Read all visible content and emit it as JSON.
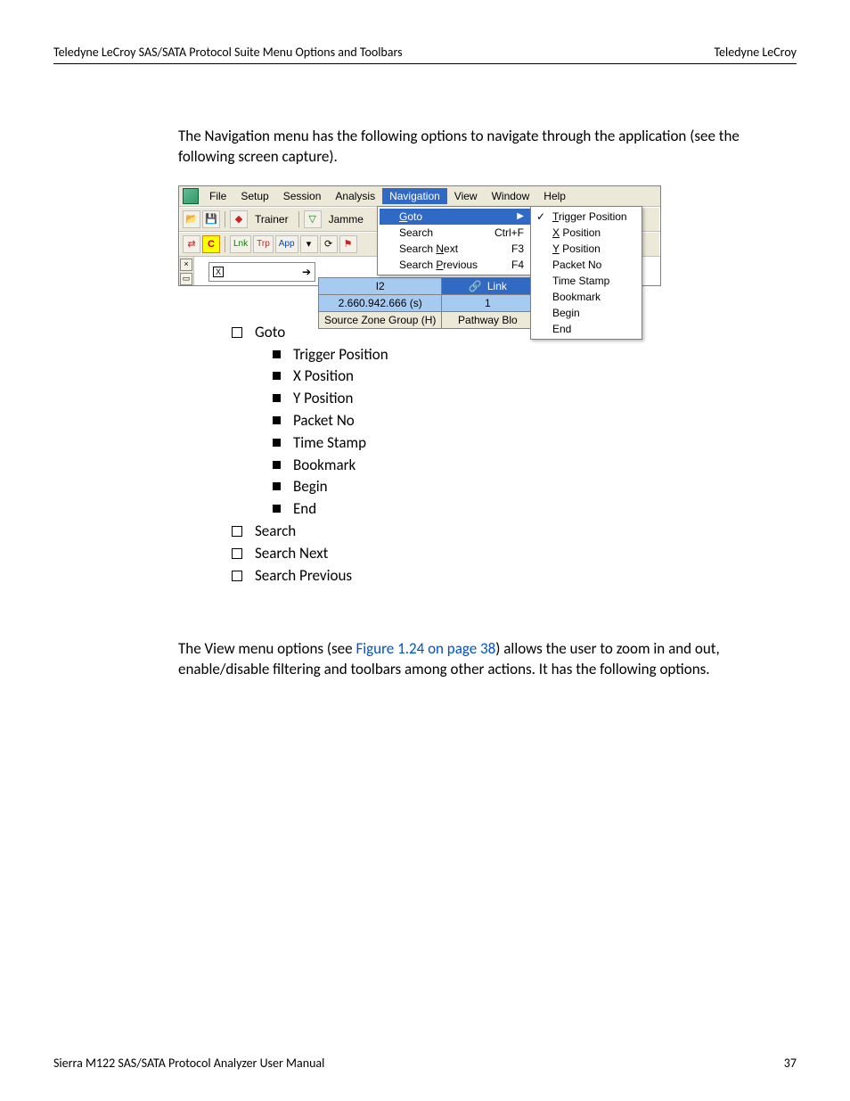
{
  "header": {
    "left": "Teledyne LeCroy SAS/SATA Protocol Suite Menu Options and Toolbars",
    "right": "Teledyne LeCroy"
  },
  "para1": "The Navigation menu has the following options to navigate through the application (see the following screen capture).",
  "screenshot": {
    "menubar": [
      "File",
      "Setup",
      "Session",
      "Analysis",
      "Navigation",
      "View",
      "Window",
      "Help"
    ],
    "toolbar1": {
      "trainer": "Trainer",
      "jamme": "Jamme"
    },
    "toolbar2": {
      "lnk": "Lnk",
      "trp": "Trp",
      "app": "App"
    },
    "grid": {
      "i2": "I2",
      "time": "2.660.942.666 (s)",
      "link": "Link",
      "one": "1",
      "src": "Source Zone Group (H)",
      "path": "Pathway Blo"
    },
    "navmenu": [
      {
        "label": "Goto",
        "shortcut": "",
        "arrow": true
      },
      {
        "label": "Search",
        "shortcut": "Ctrl+F"
      },
      {
        "label": "Search Next",
        "shortcut": "F3"
      },
      {
        "label": "Search Previous",
        "shortcut": "F4"
      }
    ],
    "gotomenu": [
      "Trigger Position",
      "X Position",
      "Y Position",
      "Packet No",
      "Time Stamp",
      "Bookmark",
      "Begin",
      "End"
    ]
  },
  "list": {
    "top": [
      "Goto"
    ],
    "goto_items": [
      "Trigger Position",
      "X Position",
      "Y Position",
      "Packet No",
      "Time Stamp",
      "Bookmark",
      "Begin",
      "End"
    ],
    "rest": [
      "Search",
      "Search Next",
      "Search Previous"
    ]
  },
  "para2_a": "The View menu options (see ",
  "para2_link": "Figure 1.24 on page 38",
  "para2_b": ") allows the user to zoom in and out, enable/disable filtering and toolbars among other actions. It has the following options.",
  "footer": {
    "left": "Sierra M122 SAS/SATA Protocol Analyzer User Manual",
    "right": "37"
  }
}
